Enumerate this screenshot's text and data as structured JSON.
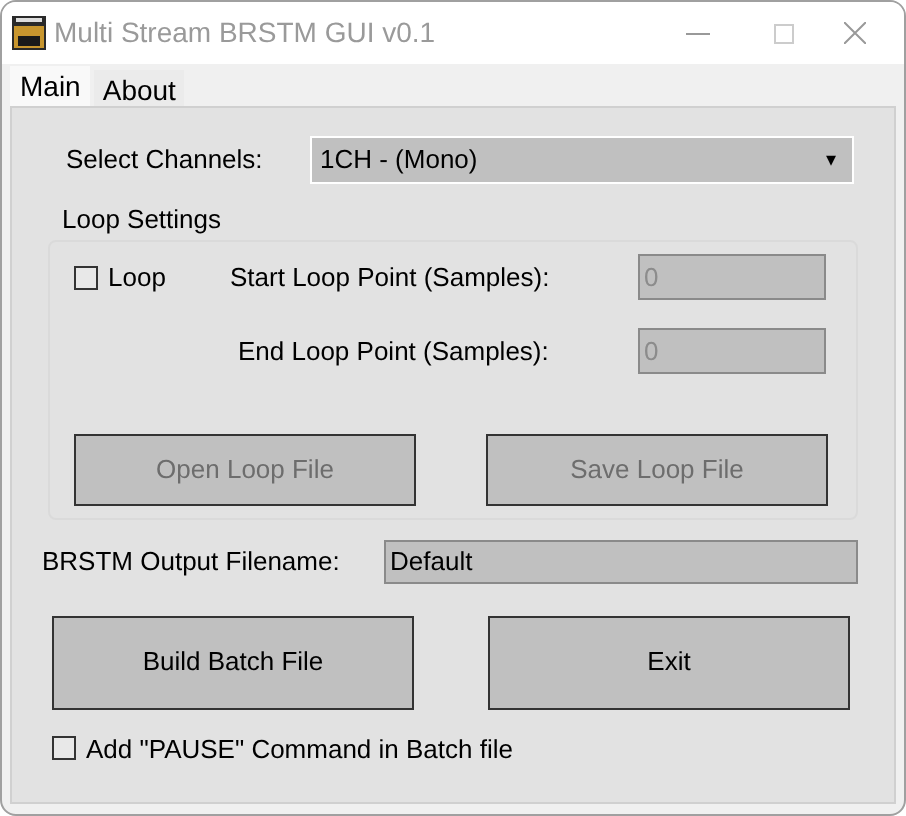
{
  "window": {
    "title": "Multi Stream BRSTM GUI v0.1"
  },
  "tabs": [
    {
      "label": "Main",
      "selected": true
    },
    {
      "label": "About",
      "selected": false
    }
  ],
  "channels": {
    "label": "Select Channels:",
    "value": "1CH - (Mono)",
    "arrow": "▾"
  },
  "loop_settings": {
    "title": "Loop Settings",
    "loop": {
      "label": "Loop",
      "checked": false
    },
    "start": {
      "label": "Start Loop Point (Samples):",
      "value": "0",
      "disabled": true
    },
    "end": {
      "label": "End Loop Point (Samples):",
      "value": "0",
      "disabled": true
    },
    "buttons": [
      {
        "label": "Open Loop File",
        "disabled": true
      },
      {
        "label": "Save Loop File",
        "disabled": true
      }
    ]
  },
  "output": {
    "label": "BRSTM Output Filename:",
    "value": "Default"
  },
  "buttons": [
    {
      "label": "Build Batch File",
      "disabled": false
    },
    {
      "label": "Exit",
      "disabled": false
    }
  ],
  "pause": {
    "label": "Add \"PAUSE\" Command in Batch file",
    "checked": false
  }
}
